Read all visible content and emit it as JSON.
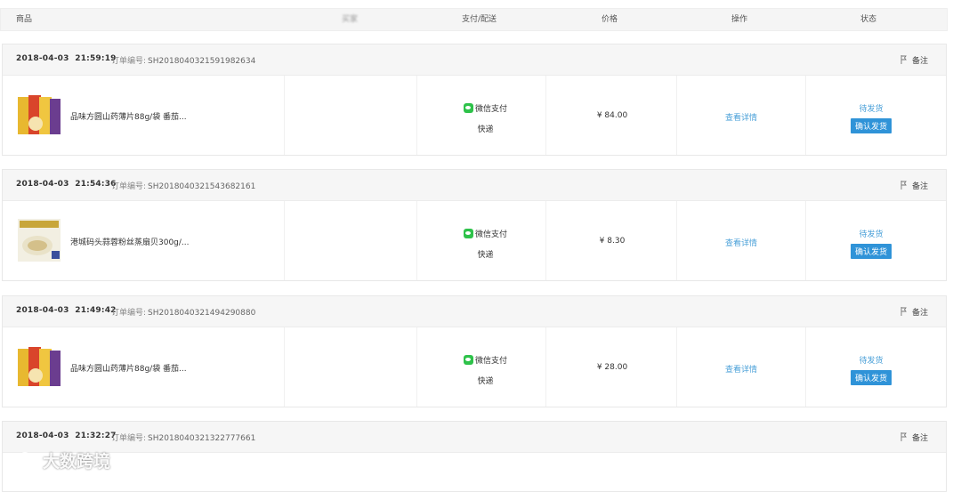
{
  "header": {
    "product": "商品",
    "buyer": "买家",
    "pay_delivery": "支付/配送",
    "price": "价格",
    "operation": "操作",
    "status": "状态"
  },
  "orders": [
    {
      "date": "2018-04-03",
      "time": "21:59:19",
      "order_label": "订单编号:",
      "order_no": "SH2018040321591982634",
      "note": "备注",
      "product_name": "品味方圆山药薄片88g/袋 番茄...",
      "payment": "微信支付",
      "delivery": "快递",
      "price": "¥ 84.00",
      "detail": "查看详情",
      "status": "待发货",
      "action": "确认发货"
    },
    {
      "date": "2018-04-03",
      "time": "21:54:36",
      "order_label": "订单编号:",
      "order_no": "SH2018040321543682161",
      "note": "备注",
      "product_name": "港城码头蒜蓉粉丝蒸扇贝300g/...",
      "payment": "微信支付",
      "delivery": "快递",
      "price": "¥ 8.30",
      "detail": "查看详情",
      "status": "待发货",
      "action": "确认发货"
    },
    {
      "date": "2018-04-03",
      "time": "21:49:42",
      "order_label": "订单编号:",
      "order_no": "SH2018040321494290880",
      "note": "备注",
      "product_name": "品味方圆山药薄片88g/袋 番茄...",
      "payment": "微信支付",
      "delivery": "快递",
      "price": "¥ 28.00",
      "detail": "查看详情",
      "status": "待发货",
      "action": "确认发货"
    },
    {
      "date": "2018-04-03",
      "time": "21:32:27",
      "order_label": "订单编号:",
      "order_no": "SH2018040321322777661",
      "note": "备注"
    }
  ],
  "watermark": "大数跨境"
}
